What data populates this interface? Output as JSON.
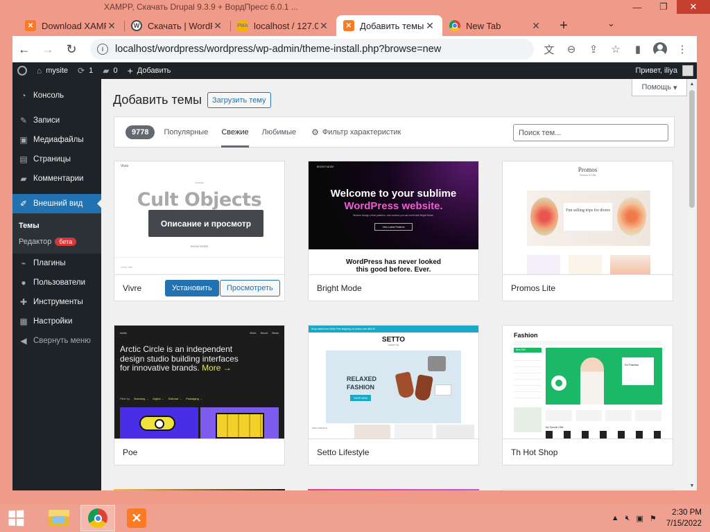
{
  "browser": {
    "window_title_ghost": "XAMPP, Скачать Drupal 9.3.9 + ВордПресс 6.0.1 ...",
    "tabs": [
      {
        "label": "Download XAMPP",
        "favicon": "xampp-icon",
        "active": false
      },
      {
        "label": "Скачать | WordPress",
        "favicon": "wordpress-icon",
        "active": false
      },
      {
        "label": "localhost / 127.0.0.1",
        "favicon": "phpmyadmin-icon",
        "active": false
      },
      {
        "label": "Добавить темы",
        "favicon": "xampp-icon",
        "active": true
      },
      {
        "label": "New Tab",
        "favicon": "chrome-icon",
        "active": false
      }
    ],
    "url": "localhost/wordpress/wordpress/wp-admin/theme-install.php?browse=new"
  },
  "adminbar": {
    "site_name": "mysite",
    "updates_count": "1",
    "comments_count": "0",
    "add_new": "Добавить",
    "greeting": "Привет, iliya"
  },
  "sidebar": {
    "items": [
      {
        "label": "Консоль",
        "icon": "dashboard-icon"
      },
      {
        "label": "Записи",
        "icon": "pin-icon"
      },
      {
        "label": "Медиафайлы",
        "icon": "media-icon"
      },
      {
        "label": "Страницы",
        "icon": "page-icon"
      },
      {
        "label": "Комментарии",
        "icon": "comment-icon"
      },
      {
        "label": "Внешний вид",
        "icon": "brush-icon"
      },
      {
        "label": "Плагины",
        "icon": "plugin-icon"
      },
      {
        "label": "Пользователи",
        "icon": "users-icon"
      },
      {
        "label": "Инструменты",
        "icon": "wrench-icon"
      },
      {
        "label": "Настройки",
        "icon": "settings-icon"
      }
    ],
    "submenu": {
      "themes": "Темы",
      "editor": "Редактор",
      "beta": "бета"
    },
    "collapse": "Свернуть меню"
  },
  "page": {
    "title": "Добавить темы",
    "upload_button": "Загрузить тему",
    "help": "Помощь",
    "theme_count": "9778",
    "filters": [
      "Популярные",
      "Свежие",
      "Любимые"
    ],
    "feature_filter": "Фильтр характеристик",
    "search_placeholder": "Поиск тем...",
    "overlay_label": "Описание и просмотр",
    "install_label": "Установить",
    "preview_label": "Просмотреть"
  },
  "themes": [
    {
      "name": "Vivre",
      "shot": {
        "headline": "Cult Objects",
        "nav": "Vivre",
        "kicker": "Events",
        "small": "SHOW MORE",
        "footer": "Vivre Site"
      }
    },
    {
      "name": "Bright Mode",
      "shot": {
        "brand": "BRIGHT MODE",
        "line1": "Welcome to your sublime",
        "line2": "WordPress website.",
        "sub": "Modern design, fresh patterns, and content you can build with Bright Mode.",
        "cta": "View Latest Patterns",
        "tag1": "WordPress has never looked",
        "tag2": "this good before. Ever."
      }
    },
    {
      "name": "Promos Lite",
      "shot": {
        "brand": "Promos",
        "tagline": "Flowers & Gifts",
        "card": "Fun selling trips for divers"
      }
    },
    {
      "name": "Poe",
      "shot": {
        "brand": "Arctic",
        "menu": [
          "Work",
          "About",
          "News"
        ],
        "text": "Arctic Circle is an independent design studio building interfaces for innovative brands.",
        "more": "More →",
        "filter_label": "Filter by",
        "filters": [
          "Branding →",
          "Digital →",
          "Editorial →",
          "Packaging →"
        ]
      }
    },
    {
      "name": "Setto Lifestyle",
      "shot": {
        "topbar": "Shop latest from Setto   Free shipping on orders over $55.00",
        "logo": "SETTO",
        "logo_sub": "LIFESTYLE",
        "headline1": "RELAXED",
        "headline2": "FASHION",
        "button": "SHOP NOW",
        "label": "NEW ARRIVALS"
      }
    },
    {
      "name": "Th Hot Shop",
      "shot": {
        "logo": "Fashion",
        "promo_title": "DJ Fashion",
        "menu_title": "Best Sell",
        "bottom": "My Special Offer"
      }
    }
  ],
  "taskbar": {
    "apps": [
      "file-explorer-icon",
      "chrome-icon",
      "xampp-icon"
    ],
    "time": "2:30 PM",
    "date": "7/15/2022"
  },
  "colors": {
    "wp_dark": "#1d2327",
    "wp_blue": "#2271b1",
    "window_frame": "#f09a8a",
    "beta_red": "#d63638"
  }
}
